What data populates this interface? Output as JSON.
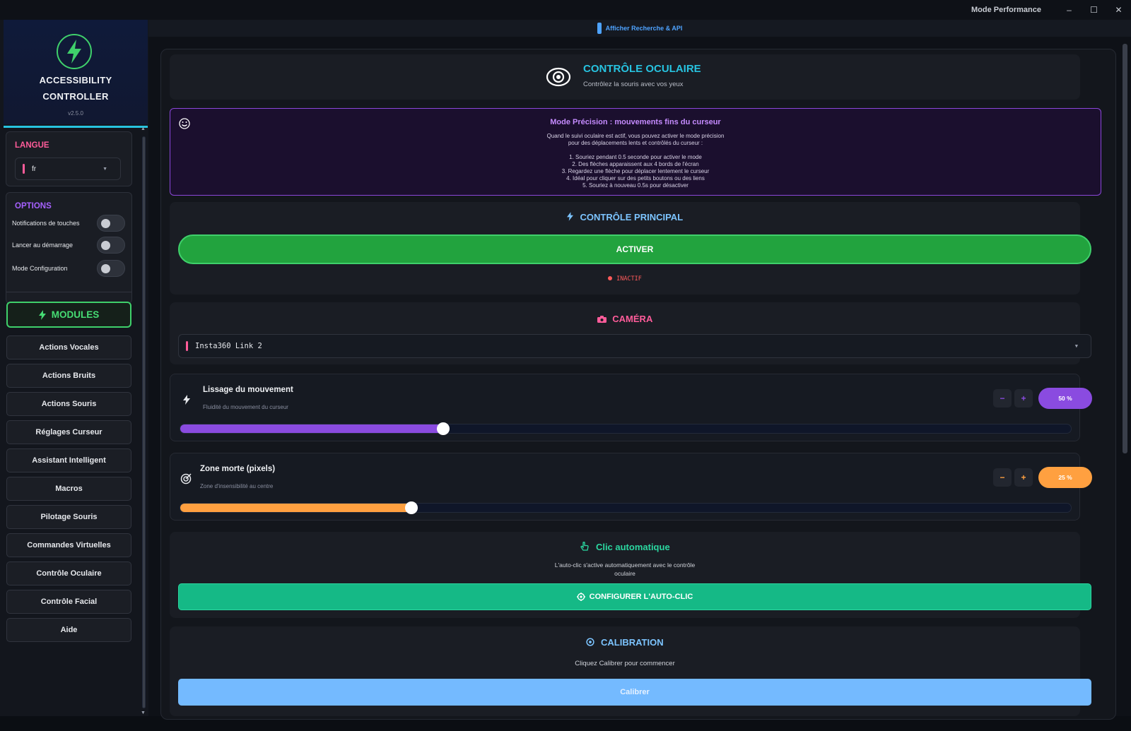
{
  "window": {
    "mode_label": "Mode Performance",
    "controls": {
      "minimize": "–",
      "maximize": "☐",
      "close": "✕"
    }
  },
  "brand": {
    "title_line1": "ACCESSIBILITY",
    "title_line2": "CONTROLLER",
    "version": "v2.5.0",
    "logo_icon": "lightning-bolt",
    "accent": "#3fd06b"
  },
  "language": {
    "title": "LANGUE",
    "selected": "fr",
    "title_color": "#ff5c9a"
  },
  "options": {
    "title": "OPTIONS",
    "title_color": "#a661ff",
    "items": [
      {
        "label": "Notifications de touches",
        "on": false
      },
      {
        "label": "Lancer au démarrage",
        "on": false
      },
      {
        "label": "Mode Configuration",
        "on": false
      }
    ]
  },
  "modules": {
    "label": "MODULES",
    "items": [
      "Actions Vocales",
      "Actions Bruits",
      "Actions Souris",
      "Réglages Curseur",
      "Assistant Intelligent",
      "Macros",
      "Pilotage Souris",
      "Commandes Virtuelles",
      "Contrôle Oculaire",
      "Contrôle Facial",
      "Aide"
    ]
  },
  "topbar": {
    "label": "Afficher Recherche & API"
  },
  "header": {
    "title": "CONTRÔLE OCULAIRE",
    "subtitle": "Contrôlez la souris avec vos yeux",
    "icon": "eye-icon",
    "title_color": "#27c3e0"
  },
  "precision": {
    "title": "Mode Précision : mouvements fins du curseur",
    "intro1": "Quand le suivi oculaire est actif, vous pouvez activer le mode précision",
    "intro2": "pour des déplacements lents et contrôlés du curseur :",
    "steps": [
      "1. Souriez pendant 0.5 seconde pour activer le mode",
      "2. Des flèches apparaissent aux 4 bords de l'écran",
      "3. Regardez une flèche pour déplacer lentement le curseur",
      "4. Idéal pour cliquer sur des petits boutons ou des liens",
      "5. Souriez à nouveau 0.5s pour désactiver"
    ]
  },
  "main_control": {
    "title": "CONTRÔLE PRINCIPAL",
    "button": "ACTIVER",
    "status": "INACTIF",
    "title_color": "#7cc4ff"
  },
  "camera": {
    "title": "CAMÉRA",
    "selected": "Insta360 Link 2",
    "title_color": "#ff5c9a"
  },
  "smoothing": {
    "title": "Lissage du mouvement",
    "subtitle": "Fluidité du mouvement du curseur",
    "value_label": "50 %",
    "value": 0.5,
    "color": "#8a4be0"
  },
  "deadzone": {
    "title": "Zone morte (pixels)",
    "subtitle": "Zone d'insensibilité au centre",
    "value_label": "25 %",
    "value": 0.25,
    "color": "#ffa040"
  },
  "autoclick": {
    "title": "Clic automatique",
    "desc1": "L'auto-clic s'active automatiquement avec le contrôle",
    "desc2": "oculaire",
    "button": "CONFIGURER L'AUTO-CLIC",
    "title_color": "#2bd7a0"
  },
  "calibration": {
    "title": "CALIBRATION",
    "desc": "Cliquez Calibrer pour commencer",
    "button": "Calibrer",
    "title_color": "#7cc4ff"
  }
}
